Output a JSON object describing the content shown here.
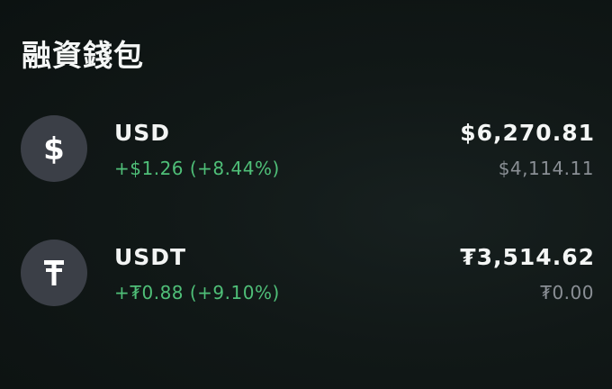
{
  "header": {
    "title": "融資錢包"
  },
  "wallets": [
    {
      "currency": "USD",
      "icon": "dollar-icon",
      "change": "+$1.26 (+8.44%)",
      "balance": "$6,270.81",
      "secondary": "$4,114.11"
    },
    {
      "currency": "USDT",
      "icon": "tether-icon",
      "change": "+₮0.88 (+9.10%)",
      "balance": "₮3,514.62",
      "secondary": "₮0.00"
    }
  ],
  "colors": {
    "background": "#111817",
    "icon_circle": "#3b3f47",
    "positive": "#4fbf78",
    "muted": "#8a8f95",
    "text": "#f4f6f5"
  }
}
